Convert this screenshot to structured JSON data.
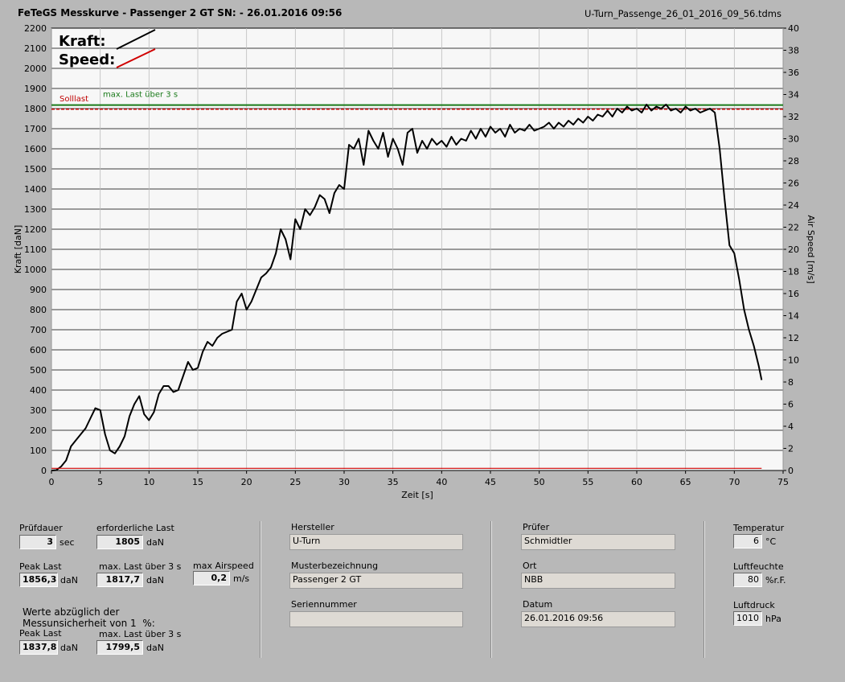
{
  "header": {
    "title": "FeTeGS Messkurve - Passenger 2 GT  SN:  - 26.01.2016 09:56",
    "filename": "U-Turn_Passenge_26_01_2016_09_56.tdms"
  },
  "chart_data": {
    "type": "line",
    "xlabel": "Zeit [s]",
    "ylabel_left": "Kraft [daN]",
    "ylabel_right": "Air Speed [m/s]",
    "xlim": [
      0,
      75
    ],
    "ylim_left": [
      0,
      2200
    ],
    "ylim_right": [
      0,
      40
    ],
    "x_ticks": [
      "0",
      "5",
      "10",
      "15",
      "20",
      "25",
      "30",
      "35",
      "40",
      "45",
      "50",
      "55",
      "60",
      "65",
      "70",
      "75"
    ],
    "y_left_ticks": [
      "0",
      "100",
      "200",
      "300",
      "400",
      "500",
      "600",
      "700",
      "800",
      "900",
      "1000",
      "1100",
      "1200",
      "1300",
      "1400",
      "1500",
      "1600",
      "1700",
      "1800",
      "1900",
      "2000",
      "2100",
      "2200"
    ],
    "y_right_ticks": [
      "0",
      "2",
      "4",
      "6",
      "8",
      "10",
      "12",
      "14",
      "16",
      "18",
      "20",
      "22",
      "24",
      "26",
      "28",
      "30",
      "32",
      "34",
      "36",
      "38",
      "40"
    ],
    "legend": [
      {
        "name": "Kraft:",
        "color": "#000000"
      },
      {
        "name": "Speed:",
        "color": "#d00000"
      }
    ],
    "reference_lines": [
      {
        "label": "Solllast",
        "value": 1805,
        "color": "#c00000"
      },
      {
        "label": "max. Last über  3 s",
        "value": 1817.7,
        "color": "#1a7a1a"
      }
    ],
    "series": [
      {
        "name": "Kraft:",
        "axis": "left",
        "color": "#000000",
        "x": [
          0,
          0.5,
          1,
          1.5,
          2,
          2.5,
          3,
          3.5,
          4,
          4.5,
          5,
          5.5,
          6,
          6.5,
          7,
          7.5,
          8,
          8.5,
          9,
          9.5,
          10,
          10.5,
          11,
          11.5,
          12,
          12.5,
          13,
          13.5,
          14,
          14.5,
          15,
          15.5,
          16,
          16.5,
          17,
          17.5,
          18,
          18.5,
          19,
          19.5,
          20,
          20.5,
          21,
          21.5,
          22,
          22.5,
          23,
          23.5,
          24,
          24.5,
          25,
          25.5,
          26,
          26.5,
          27,
          27.5,
          28,
          28.5,
          29,
          29.5,
          30,
          30.5,
          31,
          31.5,
          32,
          32.5,
          33,
          33.5,
          34,
          34.5,
          35,
          35.5,
          36,
          36.5,
          37,
          37.5,
          38,
          38.5,
          39,
          39.5,
          40,
          40.5,
          41,
          41.5,
          42,
          42.5,
          43,
          43.5,
          44,
          44.5,
          45,
          45.5,
          46,
          46.5,
          47,
          47.5,
          48,
          48.5,
          49,
          49.5,
          50,
          50.5,
          51,
          51.5,
          52,
          52.5,
          53,
          53.5,
          54,
          54.5,
          55,
          55.5,
          56,
          56.5,
          57,
          57.5,
          58,
          58.5,
          59,
          59.5,
          60,
          60.5,
          61,
          61.5,
          62,
          62.5,
          63,
          63.5,
          64,
          64.5,
          65,
          65.5,
          66,
          66.5,
          67,
          67.5,
          68,
          68.5,
          69,
          69.5,
          70,
          70.5,
          71,
          71.5,
          72,
          72.5,
          72.8
        ],
        "y": [
          0,
          2,
          20,
          50,
          120,
          150,
          180,
          210,
          260,
          310,
          300,
          180,
          100,
          85,
          120,
          170,
          270,
          330,
          370,
          280,
          250,
          290,
          380,
          420,
          420,
          390,
          400,
          470,
          540,
          500,
          510,
          590,
          640,
          620,
          660,
          680,
          690,
          700,
          840,
          880,
          800,
          840,
          900,
          960,
          980,
          1010,
          1080,
          1200,
          1150,
          1050,
          1250,
          1200,
          1300,
          1270,
          1310,
          1370,
          1350,
          1280,
          1380,
          1420,
          1400,
          1620,
          1600,
          1650,
          1520,
          1690,
          1640,
          1600,
          1680,
          1560,
          1650,
          1600,
          1520,
          1680,
          1700,
          1580,
          1640,
          1600,
          1650,
          1620,
          1640,
          1610,
          1660,
          1620,
          1650,
          1640,
          1690,
          1650,
          1700,
          1660,
          1710,
          1680,
          1700,
          1660,
          1720,
          1680,
          1700,
          1690,
          1720,
          1690,
          1700,
          1710,
          1730,
          1700,
          1730,
          1710,
          1740,
          1720,
          1750,
          1730,
          1760,
          1740,
          1770,
          1760,
          1790,
          1760,
          1800,
          1780,
          1810,
          1790,
          1800,
          1780,
          1820,
          1790,
          1810,
          1800,
          1820,
          1790,
          1800,
          1780,
          1810,
          1790,
          1800,
          1780,
          1790,
          1800,
          1780,
          1600,
          1350,
          1120,
          1080,
          950,
          800,
          700,
          620,
          520,
          450
        ]
      },
      {
        "name": "Speed:",
        "axis": "right",
        "color": "#d00000",
        "x": [
          0,
          72.8
        ],
        "y": [
          0.2,
          0.2
        ]
      }
    ]
  },
  "panel": {
    "pruefdauer": {
      "label": "Prüfdauer",
      "value": "3",
      "unit": "sec"
    },
    "erforderliche_last": {
      "label": "erforderliche Last",
      "value": "1805",
      "unit": "daN"
    },
    "peak_last": {
      "label": "Peak Last",
      "value": "1856,3",
      "unit": "daN"
    },
    "max_last": {
      "label": "max. Last über  3 s",
      "value": "1817,7",
      "unit": "daN"
    },
    "max_airspeed": {
      "label": "max Airspeed",
      "value": "0,2",
      "unit": "m/s"
    },
    "werte_note": "Werte abzüglich der\nMessunsicherheit von 1  %:",
    "peak_last2": {
      "label": "Peak Last",
      "value": "1837,8",
      "unit": "daN"
    },
    "max_last2": {
      "label": "max. Last über  3 s",
      "value": "1799,5",
      "unit": "daN"
    },
    "hersteller": {
      "label": "Hersteller",
      "value": "U-Turn"
    },
    "musterbezeichnung": {
      "label": "Musterbezeichnung",
      "value": "Passenger 2 GT"
    },
    "seriennummer": {
      "label": "Seriennummer",
      "value": ""
    },
    "pruefer": {
      "label": "Prüfer",
      "value": "Schmidtler"
    },
    "ort": {
      "label": "Ort",
      "value": "NBB"
    },
    "datum": {
      "label": "Datum",
      "value": "26.01.2016 09:56"
    },
    "temperatur": {
      "label": "Temperatur",
      "value": "6",
      "unit": "°C"
    },
    "luftfeuchte": {
      "label": "Luftfeuchte",
      "value": "80",
      "unit": "%r.F."
    },
    "luftdruck": {
      "label": "Luftdruck",
      "value": "1010",
      "unit": "hPa"
    }
  }
}
